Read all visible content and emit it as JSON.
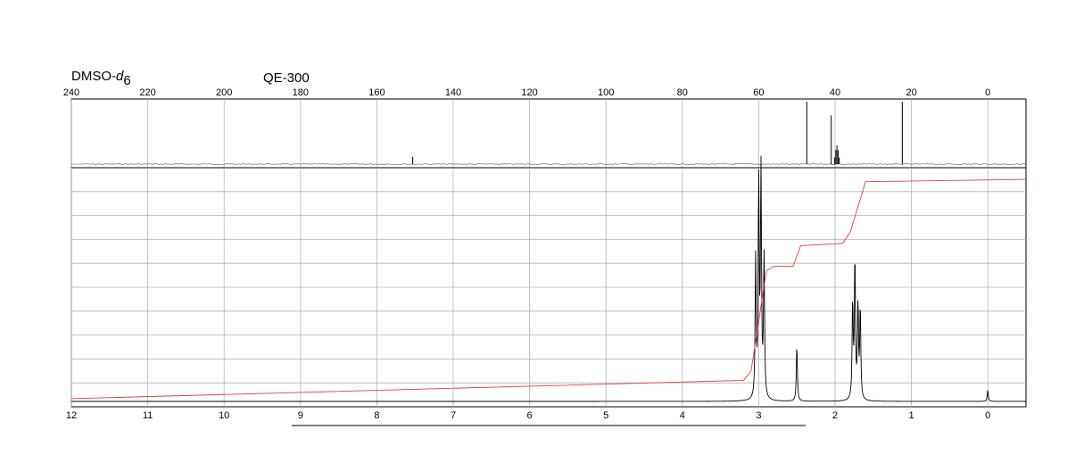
{
  "header": {
    "solvent": "DMSO-",
    "solvent_italic": "d",
    "solvent_sub": "6",
    "instrument": "QE-300"
  },
  "chart_data": [
    {
      "type": "line",
      "name": "13C NMR spectrum",
      "xlabel": "",
      "ylabel": "",
      "xlim": [
        240,
        -10
      ],
      "x_ticks": [
        240,
        220,
        200,
        180,
        160,
        140,
        120,
        100,
        80,
        60,
        40,
        20,
        0
      ],
      "x_tick_labels": [
        "240",
        "220",
        "200",
        "180",
        "160",
        "140",
        "120",
        "100",
        "80",
        "60",
        "40",
        "20",
        "0"
      ],
      "grid": true,
      "peaks": [
        {
          "shift": 150.6,
          "height": 0.12
        },
        {
          "shift": 47.4,
          "height": 1.0
        },
        {
          "shift": 41.0,
          "height": 0.78
        },
        {
          "shift": 39.5,
          "height": 0.3,
          "solvent_multiplet": true
        },
        {
          "shift": 22.4,
          "height": 1.0
        }
      ]
    },
    {
      "type": "line",
      "name": "1H NMR spectrum",
      "xlabel": "",
      "ylabel": "",
      "xlim": [
        12,
        -0.5
      ],
      "x_ticks": [
        12,
        11,
        10,
        9,
        8,
        7,
        6,
        5,
        4,
        3,
        2,
        1,
        0
      ],
      "x_tick_labels": [
        "12",
        "11",
        "10",
        "9",
        "8",
        "7",
        "6",
        "5",
        "4",
        "3",
        "2",
        "1",
        "0"
      ],
      "grid": true,
      "peaks": [
        {
          "shift": 3.04,
          "height": 0.62
        },
        {
          "shift": 3.0,
          "height": 0.95
        },
        {
          "shift": 2.97,
          "height": 1.0
        },
        {
          "shift": 2.93,
          "height": 0.64
        },
        {
          "shift": 2.5,
          "height": 0.25
        },
        {
          "shift": 1.77,
          "height": 0.43
        },
        {
          "shift": 1.74,
          "height": 0.63
        },
        {
          "shift": 1.7,
          "height": 0.42
        },
        {
          "shift": 1.67,
          "height": 0.41
        },
        {
          "shift": 0.0,
          "height": 0.05
        }
      ],
      "integral": [
        {
          "shift": 12.0,
          "level": 0.02
        },
        {
          "shift": 3.2,
          "level": 0.1
        },
        {
          "shift": 3.1,
          "level": 0.14
        },
        {
          "shift": 2.9,
          "level": 0.58
        },
        {
          "shift": 2.8,
          "level": 0.6
        },
        {
          "shift": 2.55,
          "level": 0.6
        },
        {
          "shift": 2.45,
          "level": 0.69
        },
        {
          "shift": 1.9,
          "level": 0.7
        },
        {
          "shift": 1.8,
          "level": 0.75
        },
        {
          "shift": 1.6,
          "level": 0.97
        },
        {
          "shift": -0.5,
          "level": 0.98
        }
      ]
    }
  ]
}
